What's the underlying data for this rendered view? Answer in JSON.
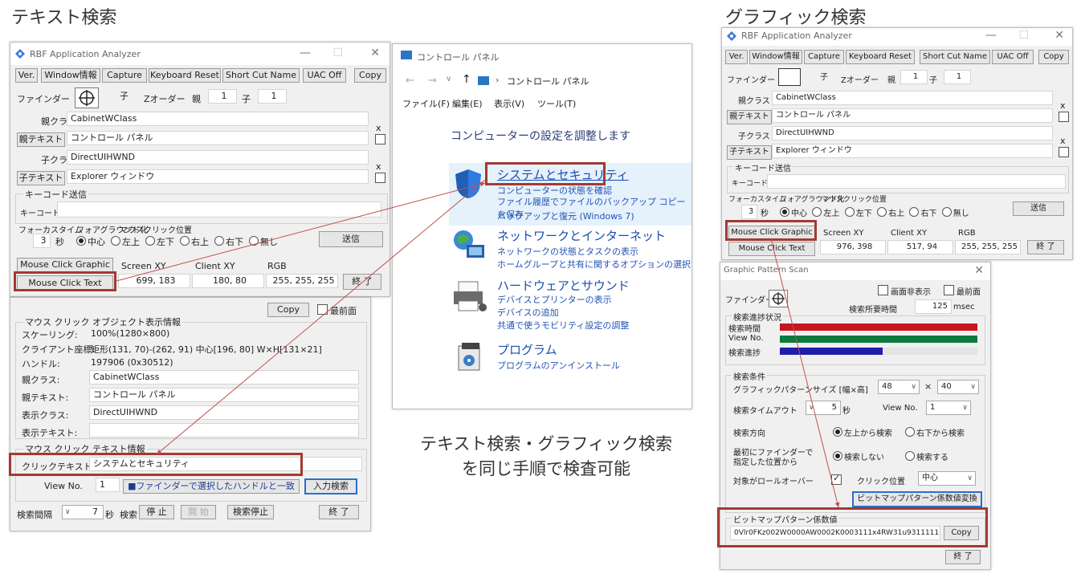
{
  "headings": {
    "text_search": "テキスト検索",
    "graphic_search": "グラフィック検索",
    "caption_line1": "テキスト検索・グラフィック検索",
    "caption_line2": "を同じ手順で検査可能"
  },
  "app": {
    "title": "RBF Application Analyzer",
    "minimize": "—",
    "maximize": "☐",
    "close": "✕",
    "toolbar": [
      "Ver.",
      "Window情報",
      "Capture",
      "Keyboard Reset",
      "Short Cut Name",
      "UAC Off",
      "Copy"
    ],
    "finder_label": "ファインダー",
    "child_label": "子",
    "zorder_label": "Zオーダー",
    "parent_short": "親",
    "parent_val": "1",
    "child_short": "子",
    "child_val": "1",
    "parent_class_label": "親クラス",
    "parent_text_button": "親テキスト",
    "child_class_label": "子クラス",
    "child_text_button": "子テキスト",
    "keycode_group": "キーコード送信",
    "keycode_label": "キーコード:",
    "focus_style": "フォーカスタイム",
    "foreground": "フォアグラウンド化",
    "mouse_click_pos": "マウスクリック位置",
    "seconds_unit": "秒",
    "radios": [
      "中心",
      "左上",
      "左下",
      "右上",
      "右下",
      "無し"
    ],
    "send": "送信",
    "mouse_click_graphic": "Mouse Click Graphic",
    "mouse_click_text": "Mouse Click Text",
    "screen_xy_label": "Screen XY",
    "client_xy_label": "Client XY",
    "rgb_label": "RGB",
    "end": "終 了",
    "x_mark": "x"
  },
  "left_app": {
    "parent_class": "CabinetWClass",
    "parent_text": "コントロール パネル",
    "child_class": "DirectUIHWND",
    "child_text": "Explorer ウィンドウ",
    "focus_seconds": "3",
    "screen_xy": "699, 183",
    "client_xy": "180, 80",
    "rgb": "255, 255, 255"
  },
  "right_app": {
    "parent_class": "CabinetWClass",
    "parent_text": "コントロール パネル",
    "child_class": "DirectUIHWND",
    "child_text": "Explorer ウィンドウ",
    "focus_seconds": "3",
    "screen_xy": "976, 398",
    "client_xy": "517, 94",
    "rgb": "255, 255, 255"
  },
  "info": {
    "copy": "Copy",
    "topmost": "最前面",
    "group_title": "マウス クリック オブジェクト表示情報",
    "rows": [
      {
        "label": "スケーリング:",
        "value": "100%(1280×800)"
      },
      {
        "label": "クライアント座標:",
        "value": "矩形(131, 70)-(262, 91) 中心[196, 80] W×H[131×21]"
      },
      {
        "label": "ハンドル:",
        "value": "197906 (0x30512)"
      },
      {
        "label": "親クラス:",
        "value": "CabinetWClass"
      },
      {
        "label": "親テキスト:",
        "value": "コントロール パネル"
      },
      {
        "label": "表示クラス:",
        "value": "DirectUIHWND"
      },
      {
        "label": "表示テキスト:",
        "value": ""
      }
    ],
    "text_group": "マウス クリック テキスト情報",
    "click_text_label": "クリックテキスト",
    "click_text_value": "システムとセキュリティ",
    "view_no_label": "View No.",
    "view_no_value": "1",
    "match_button": "■ファインダーで選択したハンドルと一致",
    "input_search": "入力検索",
    "interval_label": "検索間隔",
    "interval_value": "7",
    "seconds": "秒",
    "search_label": "検索",
    "stop": "停 止",
    "start": "開 始",
    "search_stop": "検索停止",
    "end": "終 了"
  },
  "control_panel": {
    "title": "コントロール パネル",
    "breadcrumb": "コントロール パネル",
    "menu": [
      "ファイル(F)",
      "編集(E)",
      "表示(V)",
      "ツール(T)"
    ],
    "heading": "コンピューターの設定を調整します",
    "categories": [
      {
        "title": "システムとセキュリティ",
        "links": [
          "コンピューターの状態を確認",
          "ファイル履歴でファイルのバックアップ コピーを保存",
          "バックアップと復元 (Windows 7)"
        ]
      },
      {
        "title": "ネットワークとインターネット",
        "links": [
          "ネットワークの状態とタスクの表示",
          "ホームグループと共有に関するオプションの選択"
        ]
      },
      {
        "title": "ハードウェアとサウンド",
        "links": [
          "デバイスとプリンターの表示",
          "デバイスの追加",
          "共通で使うモビリティ設定の調整"
        ]
      },
      {
        "title": "プログラム",
        "links": [
          "プログラムのアンインストール"
        ]
      }
    ]
  },
  "gps": {
    "title": "Graphic Pattern Scan",
    "close": "✕",
    "hide_screen": "画面非表示",
    "topmost": "最前面",
    "finder": "ファインダー",
    "search_time_label": "検索所要時間",
    "search_time_value": "125",
    "msec": "msec",
    "progress_group": "検索進捗状況",
    "progress": [
      {
        "label": "検索時間",
        "color": "#c8161d",
        "fraction": 1.0
      },
      {
        "label": "View No.",
        "color": "#0c7a3e",
        "fraction": 1.0
      },
      {
        "label": "検索進捗",
        "color": "#1e1eaa",
        "fraction": 0.52
      }
    ],
    "cond_group": "検索条件",
    "size_label": "グラフィックパターンサイズ [幅×高]",
    "width": "48",
    "times": "×",
    "height": "40",
    "timeout_label": "検索タイムアウト",
    "timeout_value": "5",
    "seconds": "秒",
    "view_no_label": "View No.",
    "view_no_value": "1",
    "direction_label": "検索方向",
    "dir_a": "左上から検索",
    "dir_b": "右下から検索",
    "first_pos_label1": "最初にファインダーで",
    "first_pos_label2": "指定した位置から",
    "no_search": "検索しない",
    "do_search": "検索する",
    "rollover_label": "対象がロールオーバー",
    "click_pos_label": "クリック位置",
    "click_pos_value": "中心",
    "convert_button": "ビットマップパターン係数値変換",
    "coef_group": "ビットマップパターン係数値",
    "coef_value": "0Vlr0FKz002W0000AW0002K0003111x4RW31u93111111",
    "copy": "Copy",
    "end": "終 了"
  }
}
